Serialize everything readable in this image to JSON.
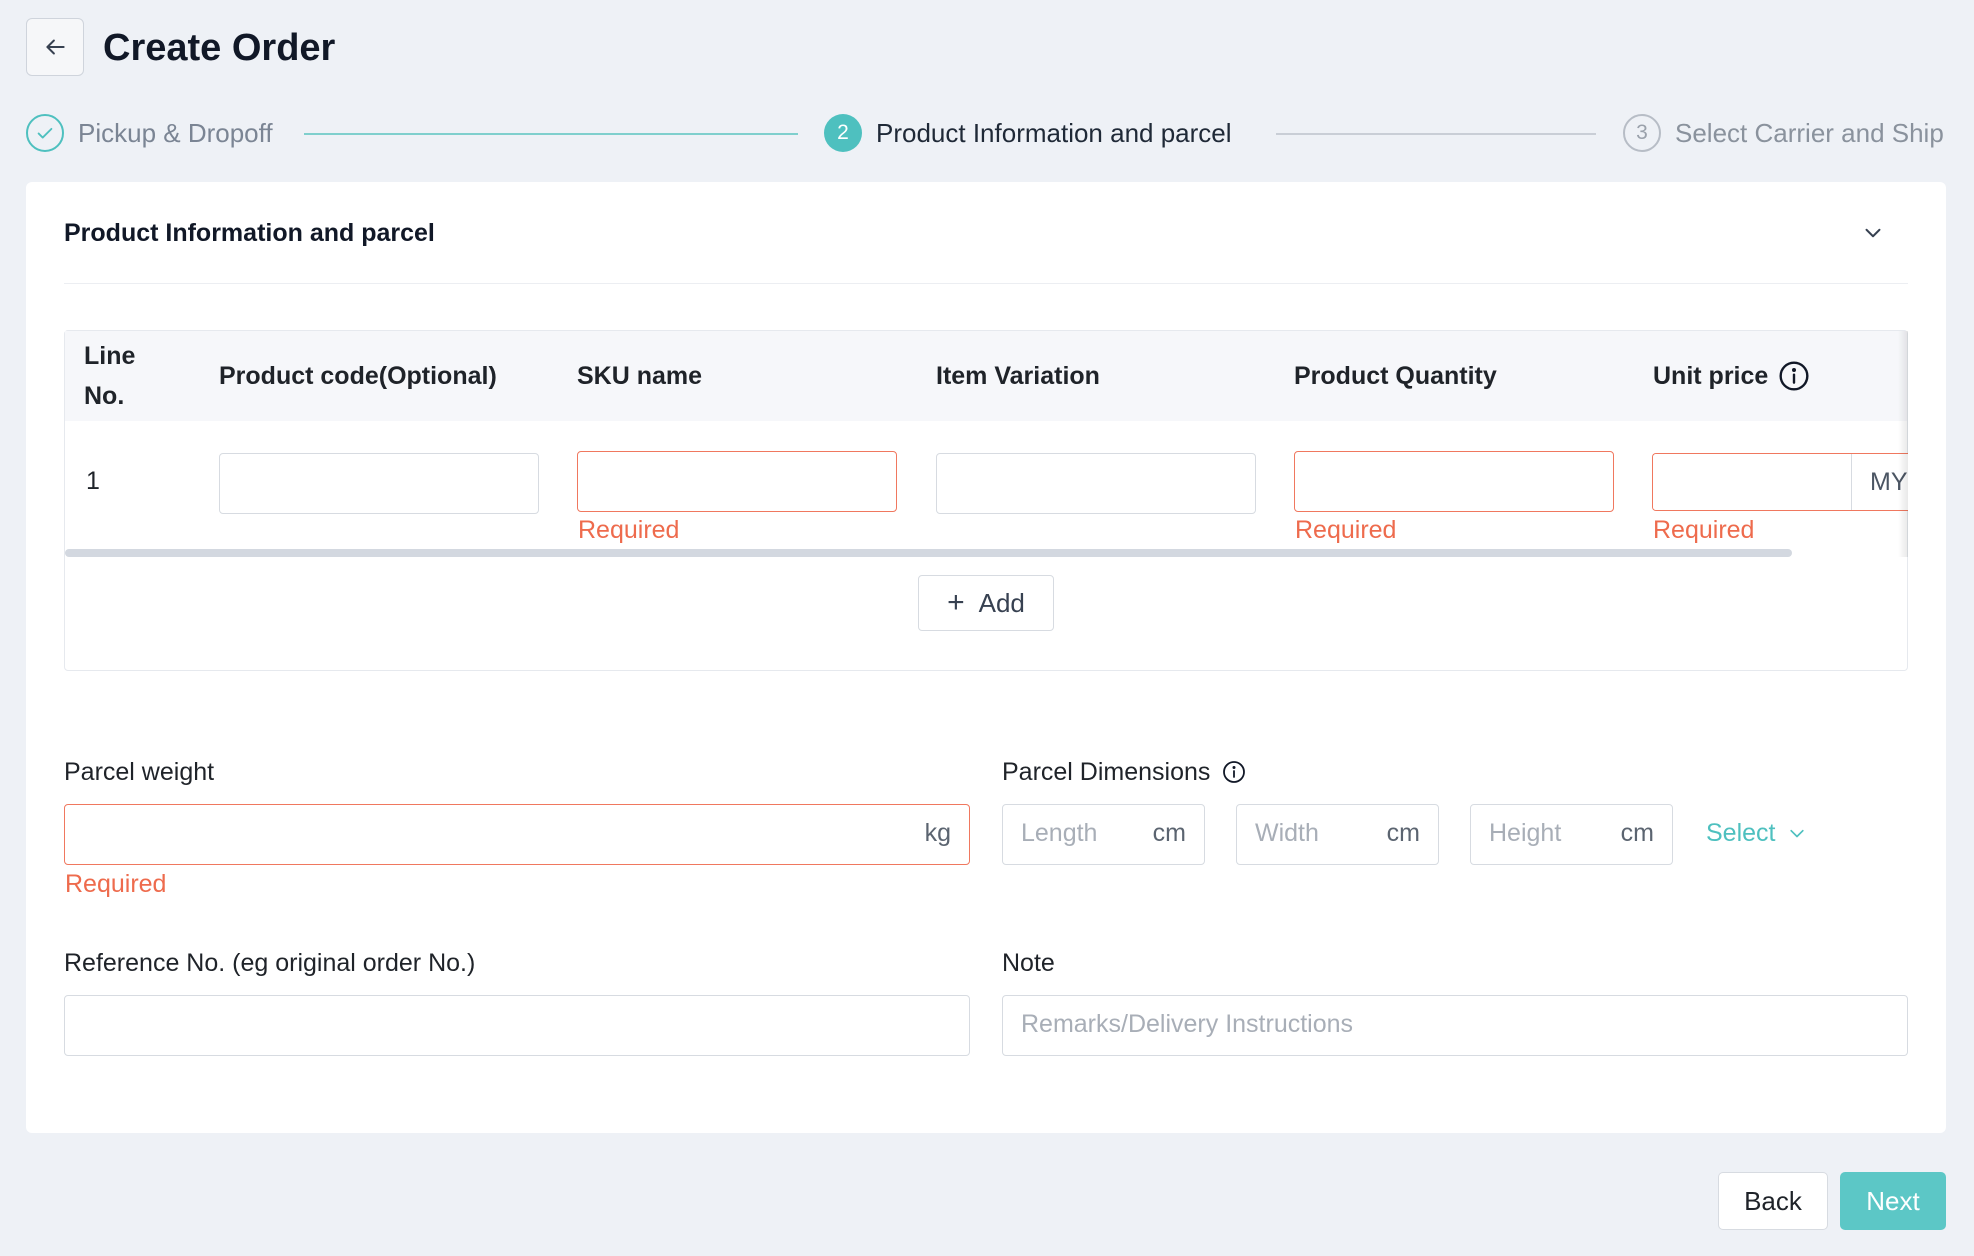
{
  "header": {
    "title": "Create Order"
  },
  "steps": [
    {
      "label": "Pickup & Dropoff",
      "status": "done"
    },
    {
      "number": "2",
      "label": "Product Information and parcel",
      "status": "active"
    },
    {
      "number": "3",
      "label": "Select Carrier and Ship",
      "status": "pending"
    }
  ],
  "section": {
    "title": "Product Information and parcel"
  },
  "table": {
    "columns": {
      "line_no_1": "Line",
      "line_no_2": "No.",
      "product_code": "Product code(Optional)",
      "sku_name": "SKU name",
      "item_variation": "Item Variation",
      "product_quantity": "Product Quantity",
      "unit_price": "Unit price"
    },
    "rows": [
      {
        "line_no": "1",
        "product_code": "",
        "sku_name": "",
        "item_variation": "",
        "product_quantity": "",
        "unit_price": "",
        "currency": "MYR"
      }
    ],
    "required_text": "Required",
    "add_label": "Add"
  },
  "form": {
    "parcel_weight": {
      "label": "Parcel weight",
      "value": "",
      "suffix": "kg",
      "error": "Required"
    },
    "parcel_dimensions": {
      "label": "Parcel Dimensions",
      "length_placeholder": "Length",
      "width_placeholder": "Width",
      "height_placeholder": "Height",
      "unit": "cm",
      "select_label": "Select"
    },
    "reference_no": {
      "label": "Reference No. (eg original order No.)",
      "value": ""
    },
    "note": {
      "label": "Note",
      "placeholder": "Remarks/Delivery Instructions",
      "value": ""
    }
  },
  "footer": {
    "back_label": "Back",
    "next_label": "Next"
  },
  "colors": {
    "accent": "#4ec0bf",
    "error": "#ee6b4d",
    "background": "#eef1f6"
  }
}
